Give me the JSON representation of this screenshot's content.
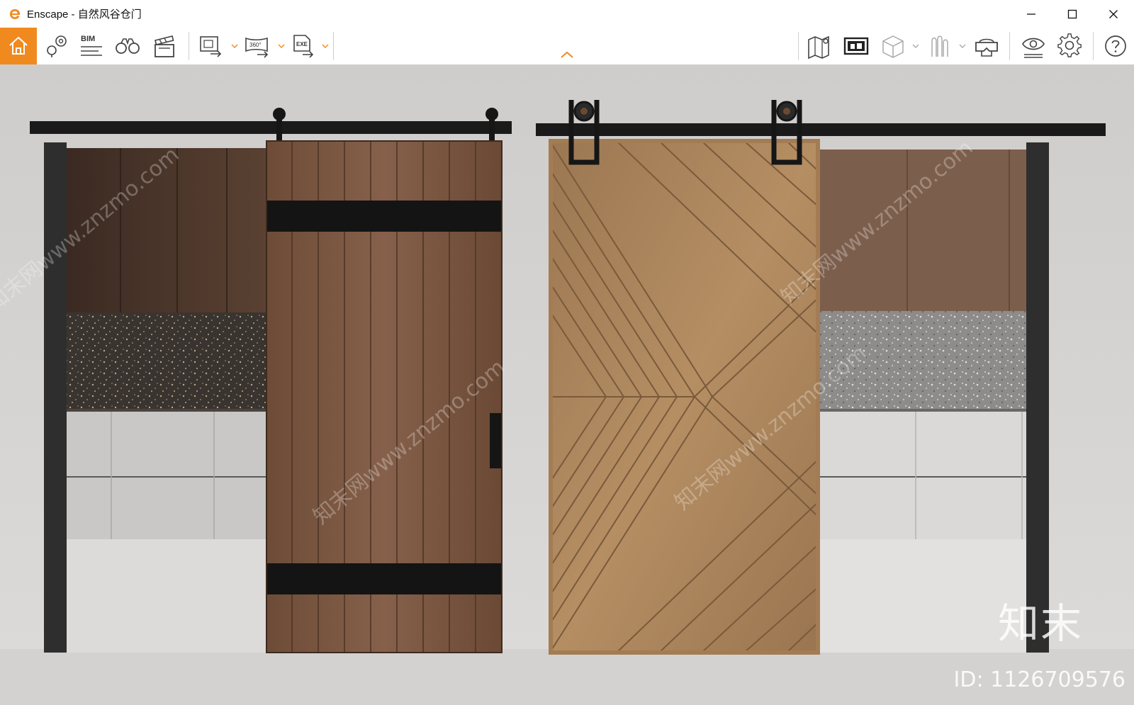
{
  "window": {
    "title": "Enscape - 自然风谷仓门",
    "controls": [
      "minimize-icon",
      "maximize-icon",
      "close-icon"
    ]
  },
  "toolbar": {
    "left_tools": [
      {
        "name": "home-icon",
        "label": ""
      },
      {
        "name": "location-icon",
        "label": ""
      },
      {
        "name": "bim-icon",
        "label": "BIM"
      },
      {
        "name": "binoculars-icon",
        "label": ""
      },
      {
        "name": "clapperboard-icon",
        "label": ""
      },
      {
        "name": "screenshot-export-icon",
        "label": ""
      },
      {
        "name": "panorama-export-icon",
        "label": "360°"
      },
      {
        "name": "exe-export-icon",
        "label": "EXE"
      }
    ],
    "right_tools": [
      {
        "name": "map-icon"
      },
      {
        "name": "presentation-icon"
      },
      {
        "name": "cube-icon"
      },
      {
        "name": "asset-library-icon"
      },
      {
        "name": "vr-headset-icon"
      },
      {
        "name": "visual-settings-icon"
      },
      {
        "name": "settings-gear-icon"
      },
      {
        "name": "help-icon"
      }
    ],
    "collapse_icon": "chevron-up-icon",
    "accent_color": "#f08a1f"
  },
  "viewport": {
    "scene": "two sliding barn doors on black rails",
    "watermark_logo": "知末",
    "watermark_id": "ID: 1126709576",
    "watermark_pattern": "知末网www.znzmo.com"
  }
}
